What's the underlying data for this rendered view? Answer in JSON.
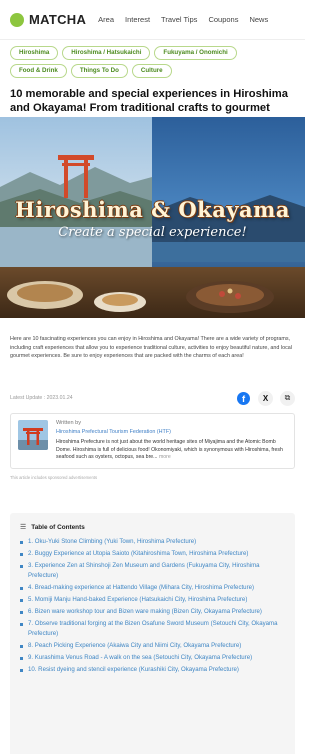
{
  "header": {
    "logo": "MATCHA",
    "nav": [
      "Area",
      "Interest",
      "Travel Tips",
      "Coupons",
      "News"
    ]
  },
  "tags": [
    "Hiroshima",
    "Hiroshima / Hatsukaichi",
    "Fukuyama / Onomichi",
    "Food & Drink",
    "Things To Do",
    "Culture"
  ],
  "article": {
    "title": "10 memorable and special experiences in Hiroshima and Okayama! From traditional crafts to gourmet food",
    "hero_title": "Hiroshima & Okayama",
    "hero_subtitle": "Create a special experience!",
    "intro": "Here are 10 fascinating experiences you can enjoy in Hiroshima and Okayama! There are a wide variety of programs, including craft experiences that allow you to experience traditional culture, activities to enjoy beautiful nature, and local gourmet experiences. Be sure to enjoy experiences that are packed with the charms of each area!",
    "date": "Latest Update : 2023.01.24"
  },
  "share": {
    "facebook": "f",
    "x": "X",
    "copy": "⧉"
  },
  "author": {
    "written_by": "Written by",
    "name": "Hiroshima Prefectural Tourism Federation (HTF)",
    "desc": "Hiroshima Prefecture is not just about the world heritage sites of Miyajima and the Atomic Bomb Dome. Hiroshima is full of delicious food! Okonomiyaki, which is synonymous with Hiroshima, fresh seafood such as oysters, octopus, sea bre...",
    "more": "more"
  },
  "disclaimer": "This article includes sponsored advertisements",
  "toc": {
    "heading": "Table of Contents",
    "items": [
      "1. Oku-Yuki Stone Climbing (Yuki Town, Hiroshima Prefecture)",
      "2. Buggy Experience at Utopia Saioto (Kitahiroshima Town, Hiroshima Prefecture)",
      "3. Experience Zen at Shinshoji Zen Museum and Gardens (Fukuyama City, Hiroshima Prefecture)",
      "4. Bread-making experience at Hattendo Village (Mihara City, Hiroshima Prefecture)",
      "5. Momiji Manju Hand-baked Experience (Hatsukaichi City, Hiroshima Prefecture)",
      "6. Bizen ware workshop tour and Bizen ware making (Bizen City, Okayama Prefecture)",
      "7. Observe traditional forging at the Bizen Osafune Sword Museum (Setouchi City, Okayama Prefecture)",
      "8. Peach Picking Experience (Akaiwa City and Niimi City, Okayama Prefecture)",
      "9. Kurashima Venus Road - A walk on the sea (Setouchi City, Okayama Prefecture)",
      "10. Resist dyeing and stencil experience (Kurashiki City, Okayama Prefecture)"
    ]
  }
}
